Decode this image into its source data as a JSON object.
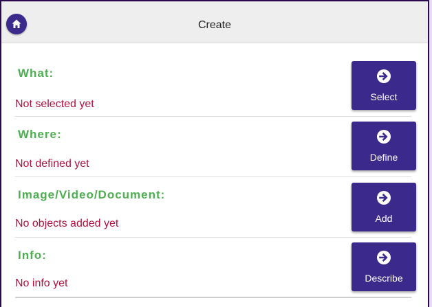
{
  "header": {
    "title": "Create",
    "home_icon": "home-icon"
  },
  "colors": {
    "accent": "#3b2a8c",
    "section_title": "#4caf50",
    "status_text": "#b0113f",
    "header_bg": "#eeeeee"
  },
  "sections": [
    {
      "title": "What:",
      "status": "Not selected yet",
      "button_label": "Select",
      "button_icon": "arrow-right-icon"
    },
    {
      "title": "Where:",
      "status": "Not defined yet",
      "button_label": "Define",
      "button_icon": "arrow-right-icon"
    },
    {
      "title": "Image/Video/Document:",
      "status": "No objects added yet",
      "button_label": "Add",
      "button_icon": "arrow-right-icon"
    },
    {
      "title": "Info:",
      "status": "No info yet",
      "button_label": "Describe",
      "button_icon": "arrow-right-icon"
    }
  ]
}
